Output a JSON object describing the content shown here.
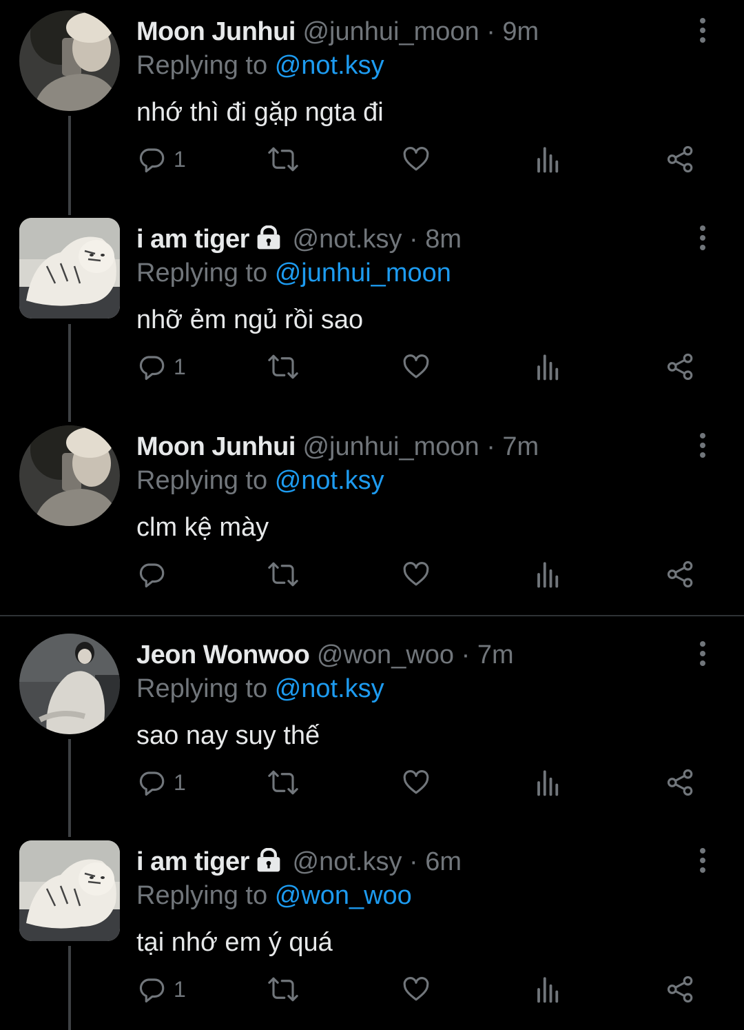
{
  "tweets": [
    {
      "name": "Moon Junhui",
      "handle": "@junhui_moon",
      "sep": "·",
      "time": "9m",
      "replying_prefix": "Replying to",
      "replying_mention": "@not.ksy",
      "text": "nhớ thì đi gặp ngta đi",
      "reply_count": "1",
      "locked": false,
      "avatar": "avatar-junhui"
    },
    {
      "name": "i am tiger",
      "handle": "@not.ksy",
      "sep": "·",
      "time": "8m",
      "replying_prefix": "Replying to",
      "replying_mention": "@junhui_moon",
      "text": "nhỡ ẻm ngủ rồi sao",
      "reply_count": "1",
      "locked": true,
      "avatar": "avatar-tiger"
    },
    {
      "name": "Moon Junhui",
      "handle": "@junhui_moon",
      "sep": "·",
      "time": "7m",
      "replying_prefix": "Replying to",
      "replying_mention": "@not.ksy",
      "text": "clm kệ mày",
      "reply_count": "",
      "locked": false,
      "avatar": "avatar-junhui"
    },
    {
      "name": "Jeon Wonwoo",
      "handle": "@won_woo",
      "sep": "·",
      "time": "7m",
      "replying_prefix": "Replying to",
      "replying_mention": "@not.ksy",
      "text": "sao nay suy thế",
      "reply_count": "1",
      "locked": false,
      "avatar": "avatar-wonwoo"
    },
    {
      "name": "i am tiger",
      "handle": "@not.ksy",
      "sep": "·",
      "time": "6m",
      "replying_prefix": "Replying to",
      "replying_mention": "@won_woo",
      "text": "tại nhớ em ý quá",
      "reply_count": "1",
      "locked": true,
      "avatar": "avatar-tiger"
    }
  ],
  "icons": {
    "reply": "reply-icon",
    "retweet": "retweet-icon",
    "like": "like-icon",
    "views": "views-icon",
    "share": "share-icon",
    "more": "more-icon",
    "lock": "lock-icon"
  },
  "colors": {
    "background": "#000000",
    "text": "#e7e9ea",
    "muted": "#71767b",
    "mention": "#1d9bf0",
    "thread_line": "#3e4144"
  }
}
